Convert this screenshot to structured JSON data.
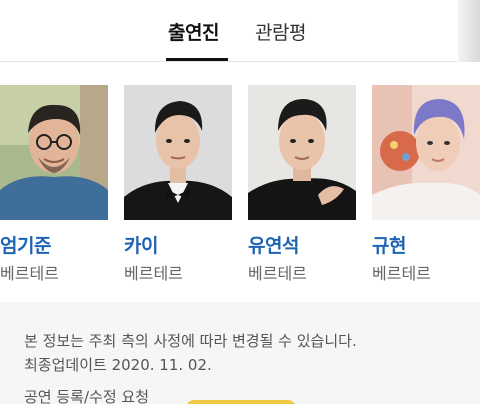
{
  "tabs": [
    {
      "label": "출연진",
      "active": true
    },
    {
      "label": "관람평",
      "active": false
    }
  ],
  "cast": [
    {
      "name": "엄기준",
      "role": "베르테르"
    },
    {
      "name": "카이",
      "role": "베르테르"
    },
    {
      "name": "유연석",
      "role": "베르테르"
    },
    {
      "name": "규현",
      "role": "베르테르"
    }
  ],
  "notice": {
    "line1": "본 정보는 주최 측의 사정에 따라 변경될 수 있습니다.",
    "line2": "최종업데이트 2020. 11. 02.",
    "report_link": "공연 등록/수정 요청"
  },
  "colors": {
    "accent_name": "#1f63b5",
    "notice_bg": "#f6f6f6",
    "button_yellow": "#f0c845"
  }
}
